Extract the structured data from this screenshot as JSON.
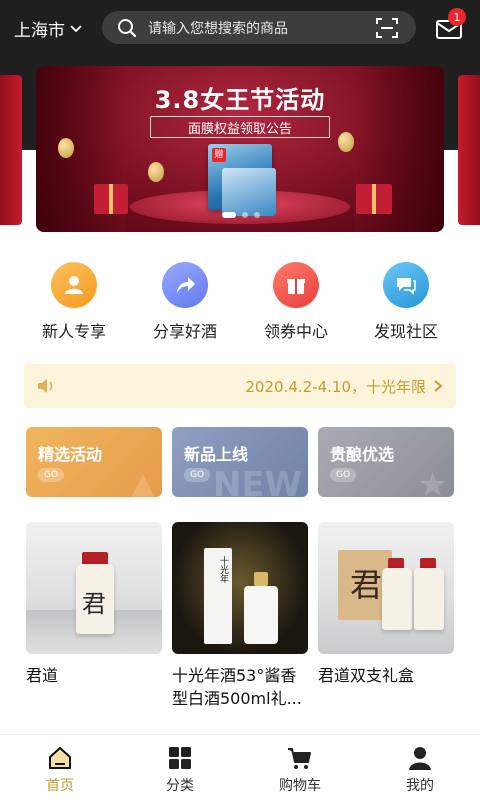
{
  "header": {
    "city": "上海市",
    "search_placeholder": "请输入您想搜索的商品",
    "message_count": "1"
  },
  "banner": {
    "title": "3.8女王节活动",
    "subtitle": "面膜权益领取公告",
    "box_tag": "赠"
  },
  "quick_nav": [
    {
      "label": "新人专享",
      "icon": "user-icon",
      "color": "#f5a623"
    },
    {
      "label": "分享好酒",
      "icon": "share-icon",
      "color": "#6d86f3"
    },
    {
      "label": "领券中心",
      "icon": "gift-icon",
      "color": "#ef5350"
    },
    {
      "label": "发现社区",
      "icon": "chat-icon",
      "color": "#37a5e6"
    }
  ],
  "notice": {
    "text": "2020.4.2-4.10，十光年限"
  },
  "promos": [
    {
      "title": "精选活动",
      "go": "GO",
      "color": "#e9a552"
    },
    {
      "title": "新品上线",
      "go": "GO",
      "color": "#7d8fb3",
      "deco": "NEW"
    },
    {
      "title": "贵酿优选",
      "go": "GO",
      "color": "#9a9da4"
    }
  ],
  "products": [
    {
      "name": "君道",
      "label_mark": "君"
    },
    {
      "name": "十光年酒53°酱香型白酒500ml礼...",
      "label_mark": "十光年"
    },
    {
      "name": "君道双支礼盒",
      "label_mark": "君"
    }
  ],
  "tabs": [
    {
      "label": "首页",
      "icon": "home-icon",
      "active": true
    },
    {
      "label": "分类",
      "icon": "category-icon"
    },
    {
      "label": "购物车",
      "icon": "cart-icon"
    },
    {
      "label": "我的",
      "icon": "profile-icon"
    }
  ],
  "colors": {
    "accent": "#c79a2e",
    "badge": "#e8282e",
    "header_bg": "#1f1f1f"
  }
}
